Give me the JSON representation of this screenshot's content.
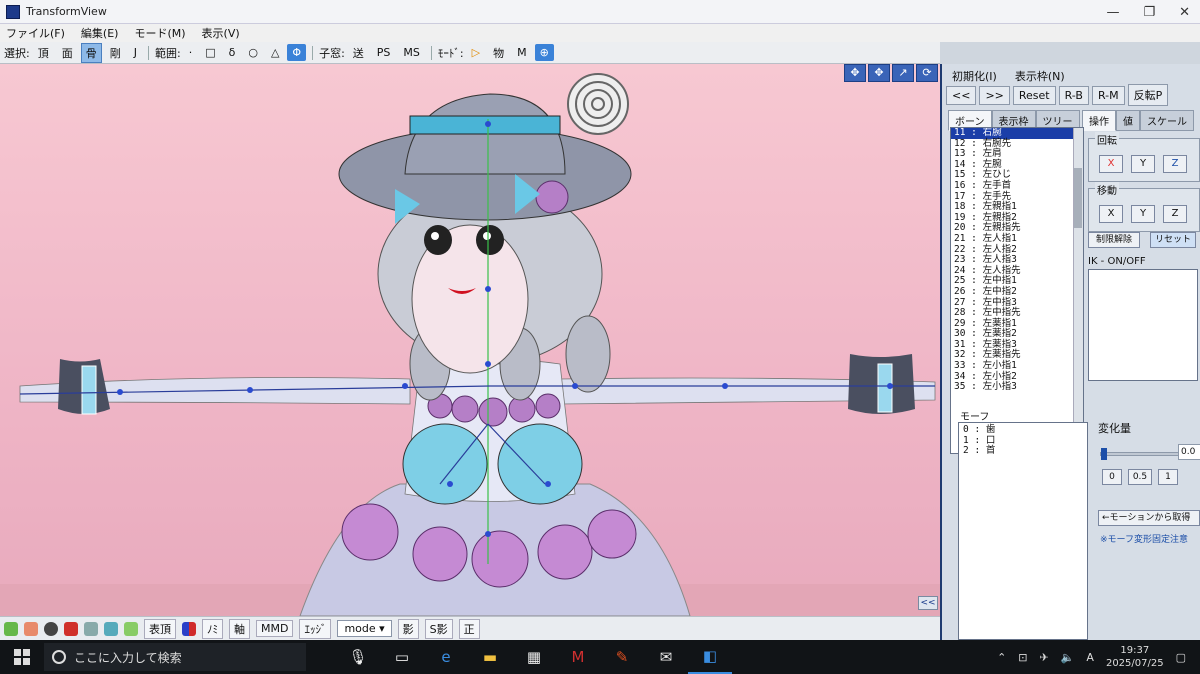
{
  "window": {
    "title": "TransformView",
    "min": "—",
    "max": "❐",
    "close": "✕"
  },
  "menu": [
    "ファイル(F)",
    "編集(E)",
    "モード(M)",
    "表示(V)"
  ],
  "toolbar": {
    "select_label": "選択:",
    "items": [
      "頂",
      "面",
      "骨",
      "剛",
      "J"
    ],
    "range_label": "範囲:",
    "range_items": [
      "·",
      "□",
      "δ",
      "○",
      "△",
      "Φ"
    ],
    "child_label": "子窓:",
    "child_items": [
      "送",
      "PS",
      "MS"
    ],
    "mode_label": "ﾓｰﾄﾞ:",
    "mode_items": [
      "▷",
      "物",
      "M"
    ]
  },
  "viewport_tools": [
    "✥",
    "✥",
    "↗",
    "⟳"
  ],
  "viewport_collapse": "<<",
  "bottombar": {
    "labels": [
      "表頂",
      "ﾉﾐ",
      "軸",
      "MMD",
      "ｴｯｼﾞ"
    ],
    "mode_select": "mode ▾",
    "right_labels": [
      "影",
      "S影",
      "正"
    ]
  },
  "panel": {
    "top_row": [
      "初期化(I)",
      "表示枠(N)"
    ],
    "second_row": [
      "<<",
      ">>",
      "Reset",
      "R-B",
      "R-M",
      "反転P"
    ],
    "left_tabs": [
      "ボーン",
      "表示枠",
      "ツリー"
    ],
    "right_tabs": [
      "操作",
      "値",
      "スケール"
    ],
    "rotation_legend": "回転",
    "move_legend": "移動",
    "xyz": [
      "X",
      "Y",
      "Z"
    ],
    "release_button": "制限解除",
    "reset_button": "リセット",
    "ik_label": "IK - ON/OFF",
    "bones": [
      "11 : 右腕",
      "12 : 右腕先",
      "13 : 左肩",
      "14 : 左腕",
      "15 : 左ひじ",
      "16 : 左手首",
      "17 : 左手先",
      "18 : 左親指1",
      "19 : 左親指2",
      "20 : 左親指先",
      "21 : 左人指1",
      "22 : 左人指2",
      "23 : 左人指3",
      "24 : 左人指先",
      "25 : 左中指1",
      "26 : 左中指2",
      "27 : 左中指3",
      "28 : 左中指先",
      "29 : 左薬指1",
      "30 : 左薬指2",
      "31 : 左薬指3",
      "32 : 左薬指先",
      "33 : 左小指1",
      "34 : 左小指2",
      "35 : 左小指3"
    ],
    "morph_label": "モーフ",
    "morphs": [
      "0 : 歯",
      "1 : 口",
      "2 : 首"
    ],
    "change_label": "変化量",
    "change_value": "0.0",
    "preset_buttons": [
      "0",
      "0.5",
      "1"
    ],
    "from_motion_button": "←モーションから取得",
    "note": "※モーフ変形固定注意"
  },
  "taskbar": {
    "search_placeholder": "ここに入力して検索",
    "time": "19:37",
    "date": "2025/07/25"
  },
  "colors": {
    "accent": "#3a82d8",
    "selection": "#1b3ea8",
    "x_red": "#e03030"
  }
}
